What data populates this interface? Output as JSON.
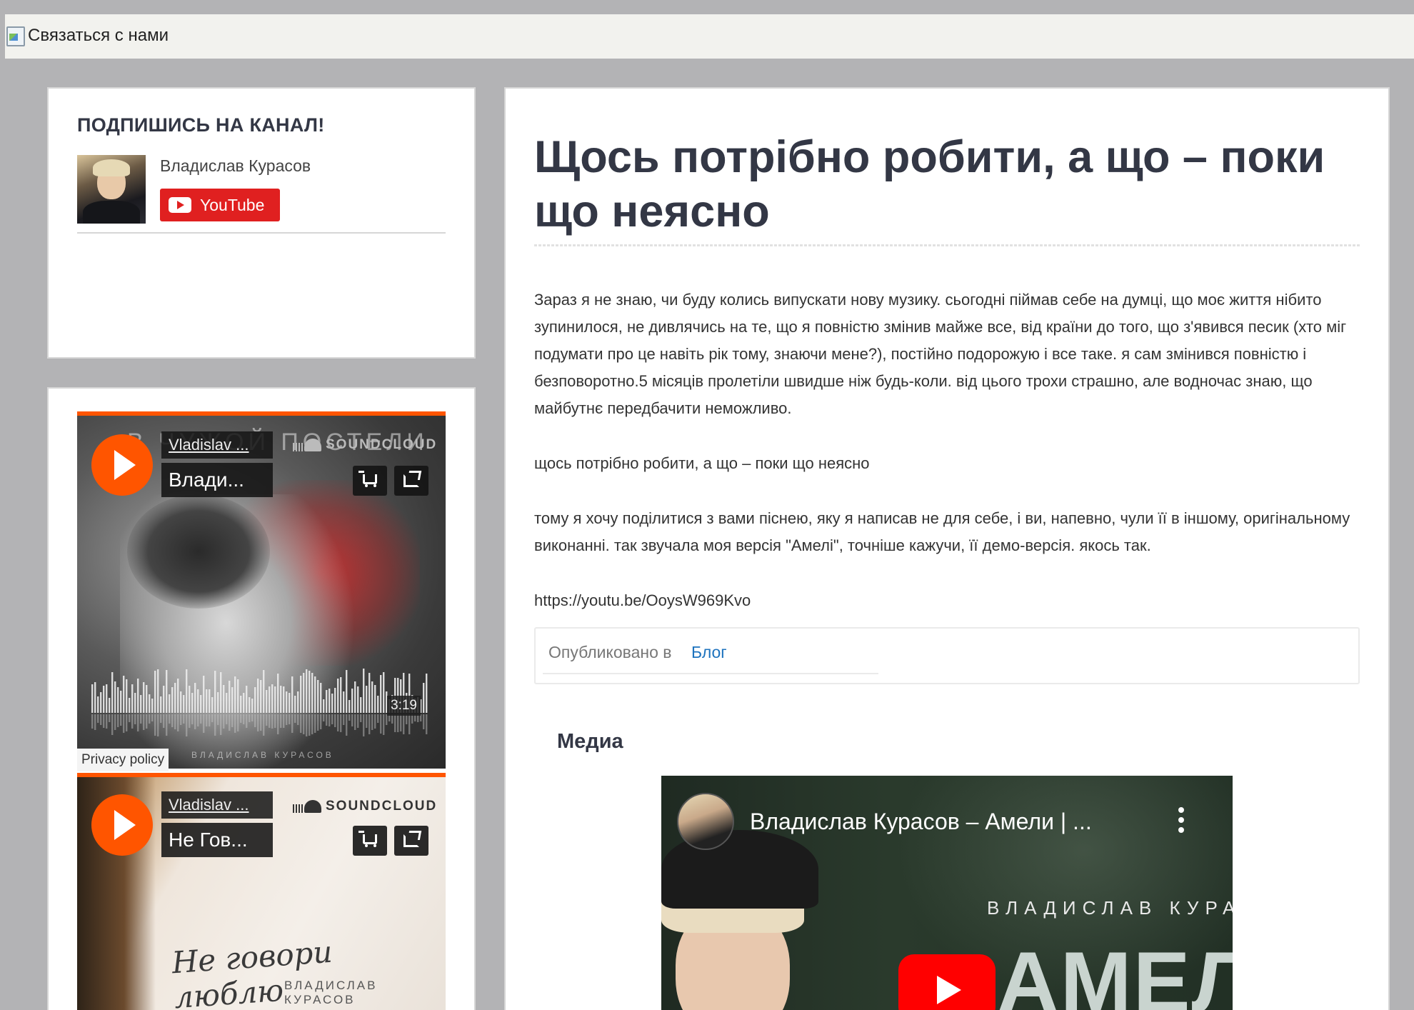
{
  "topbar": {
    "contact_label": "Связаться с нами"
  },
  "sidebar": {
    "subscribe": {
      "title": "ПОДПИШИСЬ НА КАНАЛ!",
      "channel_name": "Владислав Курасов",
      "youtube_label": "YouTube"
    },
    "players": [
      {
        "artist": "Vladislav ...",
        "track": "Влади...",
        "artwork_text": "В ЧУЖОЙ ПОСТЕЛИ",
        "artwork_credit": "ВЛАДИСЛАВ КУРАСОВ",
        "provider": "SOUNDCLOUD",
        "duration": "3:19"
      },
      {
        "artist": "Vladislav ...",
        "track": "Не Гов...",
        "artwork_text": "Не говори люблю",
        "artwork_credit": "ВЛАДИСЛАВ КУРАСОВ",
        "provider": "SOUNDCLOUD"
      }
    ],
    "privacy_label": "Privacy policy"
  },
  "article": {
    "title": "Щось потрібно робити, а що – поки що неясно",
    "paragraphs": [
      "Зараз я не знаю, чи буду колись випускати нову музику. сьогодні піймав себе на думці, що моє життя нібито зупинилося, не дивлячись на те, що я повністю змінив майже все, від країни до того, що з'явився песик (хто міг подумати про це навіть рік тому, знаючи мене?), постійно подорожую і все таке. я сам змінився повністю і безповоротно.5 місяців пролетіли швидше ніж будь-коли. від цього трохи страшно, але водночас знаю, що майбутнє передбачити неможливо.",
      "щось потрібно робити, а що – поки що неясно",
      "тому я хочу поділитися з вами піснею, яку я написав не для себе, і ви, напевно, чули її в іншому, оригінальному виконанні. так звучала моя версія \"Амелі\", точніше кажучи, її демо-версія. якось так.",
      "https://youtu.be/OoysW969Kvo"
    ],
    "posted_in_label": "Опубликовано в",
    "category": "Блог",
    "media_title": "Медиа",
    "video": {
      "title": "Владислав Курасов – Амели | ...",
      "artist_overlay": "ВЛАДИСЛАВ КУРАС",
      "song_overlay": "АМЕЛИ"
    }
  },
  "colors": {
    "soundcloud_orange": "#ff5500",
    "youtube_red": "#e02020",
    "link_blue": "#1e73be",
    "heading": "#333745",
    "page_bg": "#b3b3b5"
  }
}
